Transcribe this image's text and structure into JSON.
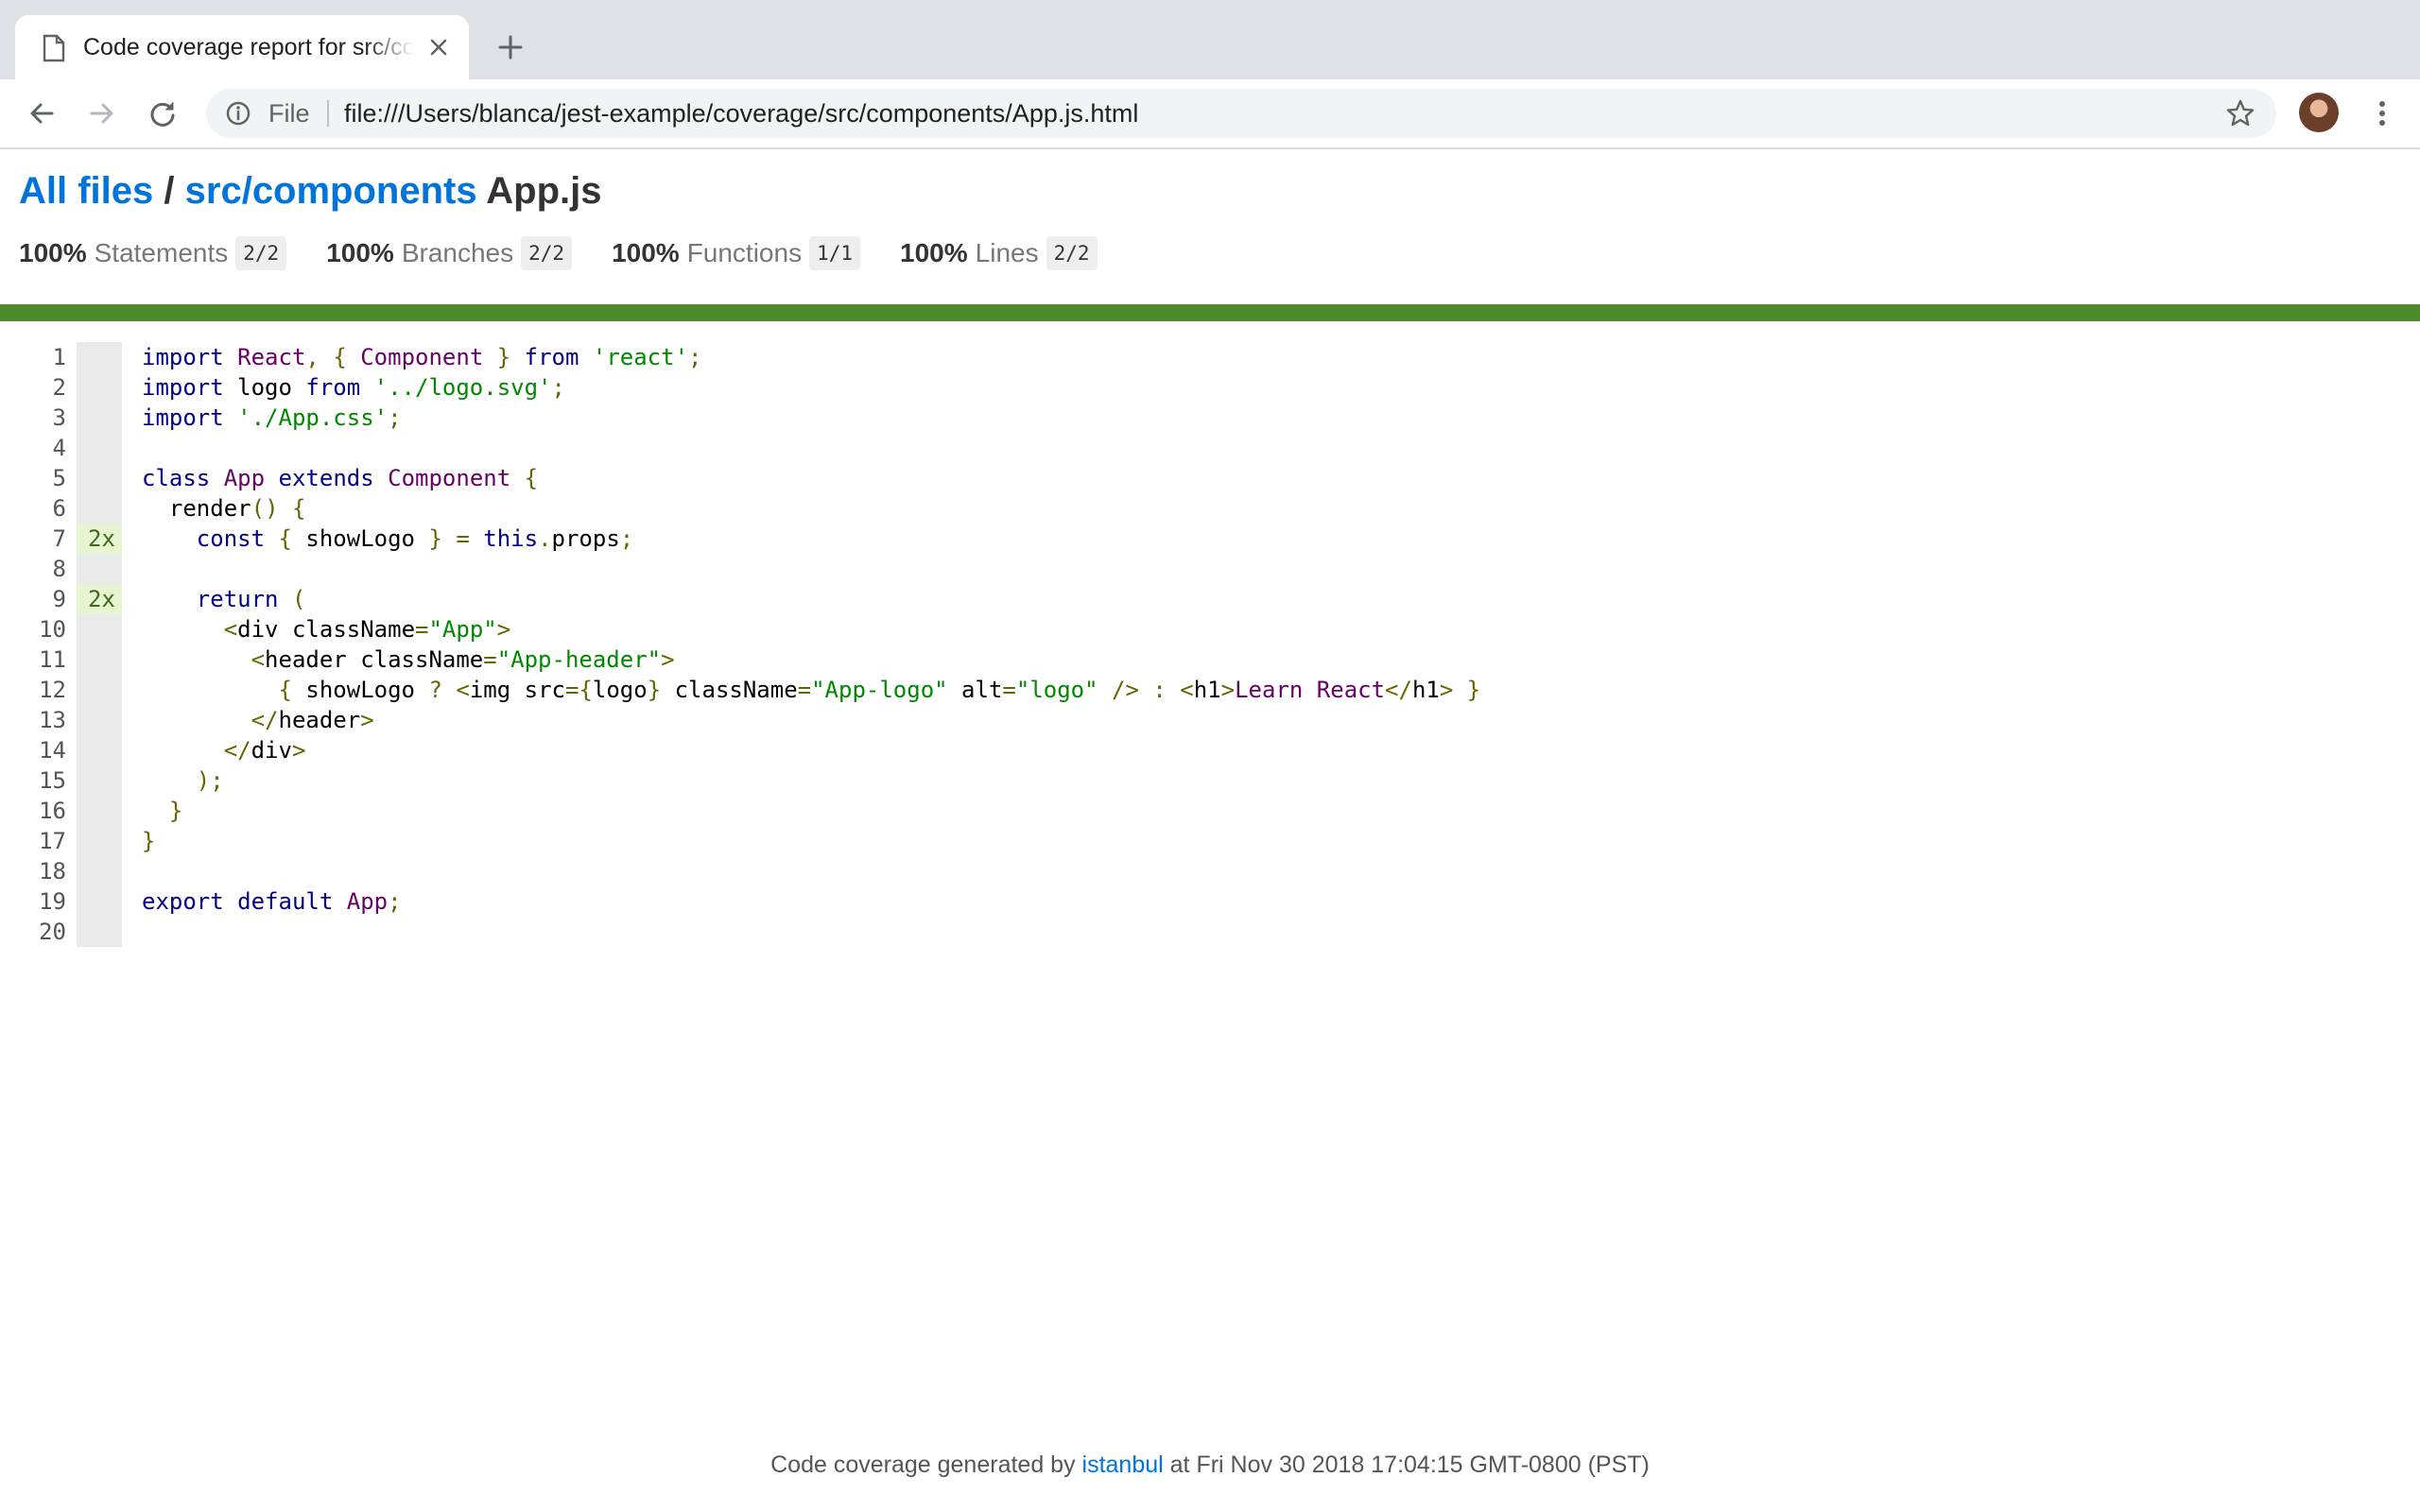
{
  "browser": {
    "tab_title": "Code coverage report for src/components/App.js",
    "scheme_label": "File",
    "url": "file:///Users/blanca/jest-example/coverage/src/components/App.js.html"
  },
  "report": {
    "breadcrumb": {
      "all_files": "All files",
      "separator": "/",
      "folder": "src/components",
      "file": "App.js"
    },
    "stats": [
      {
        "pct": "100%",
        "label": "Statements",
        "fraction": "2/2"
      },
      {
        "pct": "100%",
        "label": "Branches",
        "fraction": "2/2"
      },
      {
        "pct": "100%",
        "label": "Functions",
        "fraction": "1/1"
      },
      {
        "pct": "100%",
        "label": "Lines",
        "fraction": "2/2"
      }
    ],
    "status_color": "#4d8a2a",
    "line_numbers": [
      "1",
      "2",
      "3",
      "4",
      "5",
      "6",
      "7",
      "8",
      "9",
      "10",
      "11",
      "12",
      "13",
      "14",
      "15",
      "16",
      "17",
      "18",
      "19",
      "20"
    ],
    "hit_counts": [
      "",
      "",
      "",
      "",
      "",
      "",
      "2x",
      "",
      "2x",
      "",
      "",
      "",
      "",
      "",
      "",
      "",
      "",
      "",
      "",
      ""
    ],
    "code_lines": [
      "import React, { Component } from 'react';",
      "import logo from '../logo.svg';",
      "import './App.css';",
      "",
      "class App extends Component {",
      "  render() {",
      "    const { showLogo } = this.props;",
      "",
      "    return (",
      "      <div className=\"App\">",
      "        <header className=\"App-header\">",
      "          { showLogo ? <img src={logo} className=\"App-logo\" alt=\"logo\" /> : <h1>Learn React</h1> }",
      "        </header>",
      "      </div>",
      "    );",
      "  }",
      "}",
      "",
      "export default App;",
      ""
    ],
    "footer": {
      "prefix": "Code coverage generated by",
      "link": "istanbul",
      "suffix": "at Fri Nov 30 2018 17:04:15 GMT-0800 (PST)"
    }
  },
  "icons": {
    "tab_favicon": "page-icon",
    "tab_close": "close-icon",
    "new_tab": "plus-icon",
    "back": "arrow-left-icon",
    "forward": "arrow-right-icon",
    "reload": "reload-icon",
    "info": "info-icon",
    "bookmark": "star-icon",
    "profile": "avatar",
    "menu": "kebab-menu-icon"
  }
}
